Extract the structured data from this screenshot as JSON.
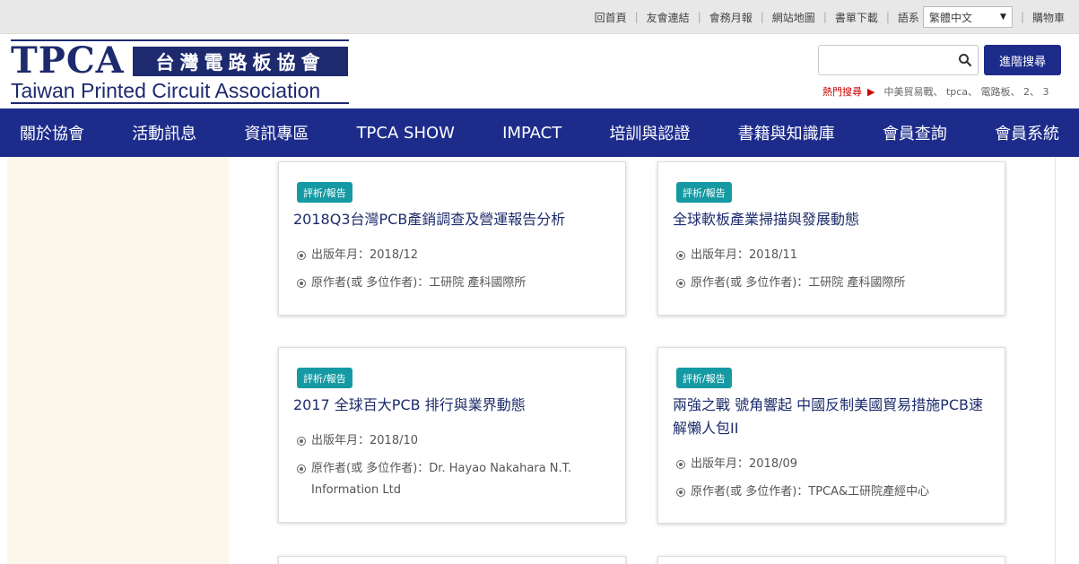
{
  "top_links": {
    "home": "回首頁",
    "friends": "友會連結",
    "monthly": "會務月報",
    "sitemap": "網站地圖",
    "forms": "書單下載",
    "lang_label": "語系",
    "lang_value": "繁體中文",
    "cart": "購物車"
  },
  "logo": {
    "abbr": "TPCA",
    "chinese": "台灣電路板協會",
    "english": "Taiwan Printed Circuit Association"
  },
  "search": {
    "placeholder": "",
    "advanced_label": "進階搜尋",
    "hot_label": "熱門搜尋",
    "hot_items": "中美貿易戰、 tpca、 電路板、 2、 3"
  },
  "nav": {
    "items": [
      "關於協會",
      "活動訊息",
      "資訊專區",
      "TPCA SHOW",
      "IMPACT",
      "培訓與認證",
      "書籍與知識庫",
      "會員查詢",
      "會員系統"
    ]
  },
  "cards": [
    {
      "badge": "評析/報告",
      "title": "2018Q3台灣PCB產銷調查及營運報告分析",
      "date": "出版年月：2018/12",
      "author": "原作者(或 多位作者)：工研院 產科國際所"
    },
    {
      "badge": "評析/報告",
      "title": "全球軟板產業掃描與發展動態",
      "date": "出版年月：2018/11",
      "author": "原作者(或 多位作者)：工研院 產科國際所"
    },
    {
      "badge": "評析/報告",
      "title": "2017 全球百大PCB 排行與業界動態",
      "date": "出版年月：2018/10",
      "author": "原作者(或 多位作者)：Dr. Hayao Nakahara N.T. Information Ltd"
    },
    {
      "badge": "評析/報告",
      "title": "兩強之戰 號角響起 中國反制美國貿易措施PCB速解懶人包II",
      "date": "出版年月：2018/09",
      "author": "原作者(或 多位作者)：TPCA&工研院產經中心"
    }
  ],
  "colors": {
    "nav_bg": "#1d2c8b",
    "badge_bg": "#159aa3",
    "title_text": "#1d2c6b",
    "hot_label": "#cc0000",
    "sidebar_bg": "#fdf6ea"
  }
}
